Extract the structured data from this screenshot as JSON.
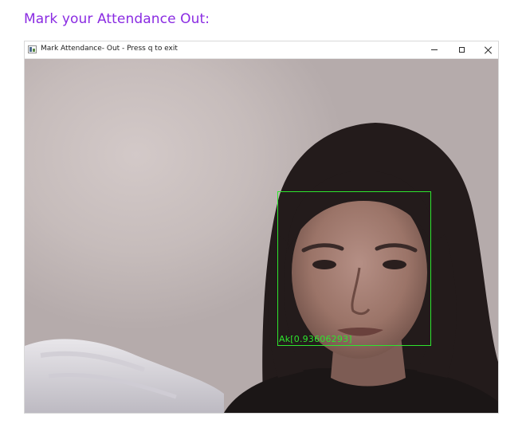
{
  "page": {
    "heading": "Mark your Attendance Out:"
  },
  "window": {
    "title": "Mark Attendance- Out - Press q to exit",
    "icon": "app-window-icon",
    "controls": {
      "minimize_icon": "minimize-icon",
      "maximize_icon": "maximize-icon",
      "close_icon": "close-icon"
    }
  },
  "detection": {
    "label": "Ak[0.93606293]",
    "box_color": "#2ee52e"
  },
  "colors": {
    "heading": "#8a2be2",
    "detection": "#2ee52e"
  }
}
